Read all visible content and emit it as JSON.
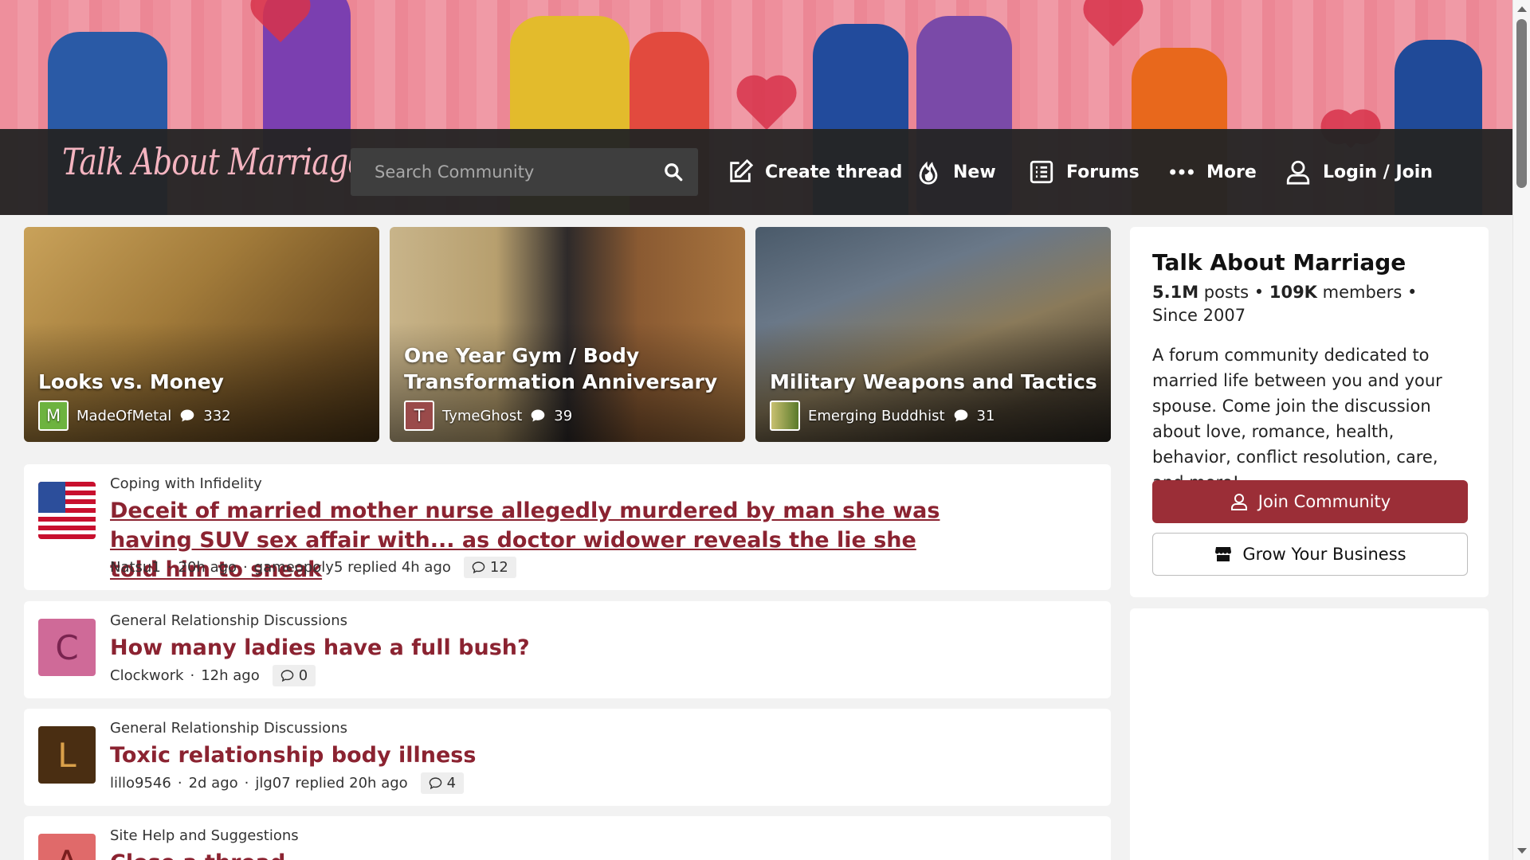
{
  "site": {
    "logo_text": "Talk About Marriage",
    "search_placeholder": "Search Community"
  },
  "nav": {
    "create_thread": "Create thread",
    "new": "New",
    "forums": "Forums",
    "more": "More",
    "login": "Login / Join"
  },
  "featured": [
    {
      "title": "Looks vs. Money",
      "author": "MadeOfMetal",
      "avatar_letter": "M",
      "avatar_color": "#6db33f",
      "replies": "332"
    },
    {
      "title": "One Year Gym / Body Transformation Anniversary",
      "author": "TymeGhost",
      "avatar_letter": "T",
      "avatar_color": "#9a4a4a",
      "replies": "39"
    },
    {
      "title": "Military Weapons and Tactics",
      "author": "Emerging Buddhist",
      "avatar_letter": "",
      "avatar_color": "#6b7d3a",
      "replies": "31"
    }
  ],
  "threads": [
    {
      "category": "Coping with Infidelity",
      "title": "Deceit of married mother nurse allegedly murdered by man she was having SUV sex affair with... as doctor widower reveals the lie she told him to sneak",
      "author": "Natsu1",
      "age": "20h ago",
      "reply_info": "gameopoly5 replied 4h ago",
      "replies": "12",
      "avatar": "flag-icon",
      "avatar_color": "#2c4e9b"
    },
    {
      "category": "General Relationship Discussions",
      "title": "How many ladies have a full bush?",
      "author": "Clockwork",
      "age": "12h ago",
      "reply_info": "",
      "replies": "0",
      "avatar_letter": "C",
      "avatar_color": "#cf6a98",
      "avatar_text_color": "#7a2450"
    },
    {
      "category": "General Relationship Discussions",
      "title": "Toxic relationship body illness",
      "author": "lillo9546",
      "age": "2d ago",
      "reply_info": "jlg07 replied 20h ago",
      "replies": "4",
      "avatar_letter": "L",
      "avatar_color": "#4a2e12",
      "avatar_text_color": "#d9a04a"
    },
    {
      "category": "Site Help and Suggestions",
      "title": "Close a thread",
      "avatar_letter": "A",
      "avatar_color": "#e06a6a",
      "avatar_text_color": "#7a1e1e"
    }
  ],
  "sidebar": {
    "community_name": "Talk About Marriage",
    "posts": "5.1M",
    "posts_label": "posts",
    "members": "109K",
    "members_label": "members",
    "since": "Since 2007",
    "description": "A forum community dedicated to married life between you and your spouse. Come join the discussion about love, romance, health, behavior, conflict resolution, care, and more!",
    "join_label": "Join Community",
    "grow_label": "Grow Your Business"
  },
  "colors": {
    "accent": "#9b2e37",
    "title_link": "#8b2331",
    "navbar": "#242424",
    "banner": "#ee8f9c"
  }
}
